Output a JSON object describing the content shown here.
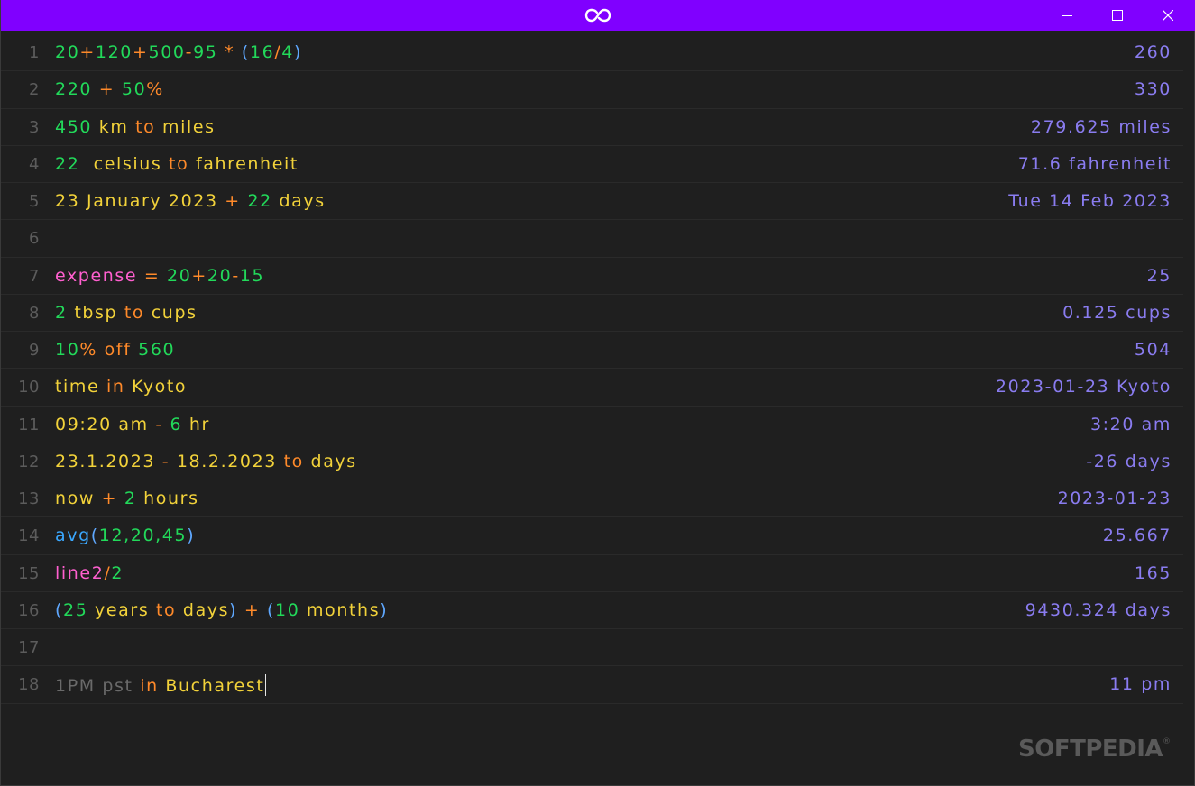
{
  "colors": {
    "titlebar": "#8000ff",
    "background": "#1f1f1f",
    "line_number": "#5c5c5c",
    "result": "#8a7cf0",
    "number": "#22d95a",
    "keyword": "#ff8a2a",
    "unit": "#f2d23a",
    "variable": "#ff5fcf",
    "paren": "#5fa8ff",
    "function": "#3aa8ff",
    "comment": "#6a6a6a"
  },
  "window": {
    "title_icon": "infinity-icon",
    "minimize_icon": "minimize-icon",
    "maximize_icon": "maximize-icon",
    "close_icon": "close-icon"
  },
  "lines": [
    {
      "n": "1",
      "tokens": [
        {
          "t": "20",
          "c": "number"
        },
        {
          "t": "+",
          "c": "keyword"
        },
        {
          "t": "120",
          "c": "number"
        },
        {
          "t": "+",
          "c": "keyword"
        },
        {
          "t": "500",
          "c": "number"
        },
        {
          "t": "-",
          "c": "keyword"
        },
        {
          "t": "95 ",
          "c": "number"
        },
        {
          "t": "* ",
          "c": "keyword"
        },
        {
          "t": "(",
          "c": "paren"
        },
        {
          "t": "16",
          "c": "number"
        },
        {
          "t": "/",
          "c": "keyword"
        },
        {
          "t": "4",
          "c": "number"
        },
        {
          "t": ")",
          "c": "paren"
        }
      ],
      "result": "260"
    },
    {
      "n": "2",
      "tokens": [
        {
          "t": "220 ",
          "c": "number"
        },
        {
          "t": "+ ",
          "c": "keyword"
        },
        {
          "t": "50",
          "c": "number"
        },
        {
          "t": "%",
          "c": "keyword"
        }
      ],
      "result": "330"
    },
    {
      "n": "3",
      "tokens": [
        {
          "t": "450 ",
          "c": "number"
        },
        {
          "t": "km ",
          "c": "unit"
        },
        {
          "t": "to ",
          "c": "keyword"
        },
        {
          "t": "miles",
          "c": "unit"
        }
      ],
      "result": "279.625 miles"
    },
    {
      "n": "4",
      "tokens": [
        {
          "t": "22  ",
          "c": "number"
        },
        {
          "t": "celsius ",
          "c": "unit"
        },
        {
          "t": "to ",
          "c": "keyword"
        },
        {
          "t": "fahrenheit",
          "c": "unit"
        }
      ],
      "result": "71.6 fahrenheit"
    },
    {
      "n": "5",
      "tokens": [
        {
          "t": "23 January 2023 ",
          "c": "unit"
        },
        {
          "t": "+ ",
          "c": "keyword"
        },
        {
          "t": "22 ",
          "c": "number"
        },
        {
          "t": "days",
          "c": "unit"
        }
      ],
      "result": "Tue 14 Feb 2023"
    },
    {
      "n": "6",
      "tokens": [],
      "result": ""
    },
    {
      "n": "7",
      "tokens": [
        {
          "t": "expense ",
          "c": "variable"
        },
        {
          "t": "= ",
          "c": "keyword"
        },
        {
          "t": "20",
          "c": "number"
        },
        {
          "t": "+",
          "c": "keyword"
        },
        {
          "t": "20",
          "c": "number"
        },
        {
          "t": "-",
          "c": "keyword"
        },
        {
          "t": "15",
          "c": "number"
        }
      ],
      "result": "25"
    },
    {
      "n": "8",
      "tokens": [
        {
          "t": "2 ",
          "c": "number"
        },
        {
          "t": "tbsp ",
          "c": "unit"
        },
        {
          "t": "to ",
          "c": "keyword"
        },
        {
          "t": "cups",
          "c": "unit"
        }
      ],
      "result": "0.125 cups"
    },
    {
      "n": "9",
      "tokens": [
        {
          "t": "10",
          "c": "number"
        },
        {
          "t": "% off ",
          "c": "keyword"
        },
        {
          "t": "560",
          "c": "number"
        }
      ],
      "result": "504"
    },
    {
      "n": "10",
      "tokens": [
        {
          "t": "time ",
          "c": "unit"
        },
        {
          "t": "in ",
          "c": "keyword"
        },
        {
          "t": "Kyoto",
          "c": "unit"
        }
      ],
      "result": "2023-01-23 Kyoto"
    },
    {
      "n": "11",
      "tokens": [
        {
          "t": "09:20 am ",
          "c": "unit"
        },
        {
          "t": "- ",
          "c": "keyword"
        },
        {
          "t": "6 ",
          "c": "number"
        },
        {
          "t": "hr",
          "c": "unit"
        }
      ],
      "result": "3:20 am"
    },
    {
      "n": "12",
      "tokens": [
        {
          "t": "23.1.2023 ",
          "c": "unit"
        },
        {
          "t": "- ",
          "c": "keyword"
        },
        {
          "t": "18.2.2023 ",
          "c": "unit"
        },
        {
          "t": "to ",
          "c": "keyword"
        },
        {
          "t": "days",
          "c": "unit"
        }
      ],
      "result": "-26 days"
    },
    {
      "n": "13",
      "tokens": [
        {
          "t": "now ",
          "c": "unit"
        },
        {
          "t": "+ ",
          "c": "keyword"
        },
        {
          "t": "2 ",
          "c": "number"
        },
        {
          "t": "hours",
          "c": "unit"
        }
      ],
      "result": "2023-01-23"
    },
    {
      "n": "14",
      "tokens": [
        {
          "t": "avg",
          "c": "function"
        },
        {
          "t": "(",
          "c": "paren"
        },
        {
          "t": "12,20,45",
          "c": "number"
        },
        {
          "t": ")",
          "c": "paren"
        }
      ],
      "result": "25.667"
    },
    {
      "n": "15",
      "tokens": [
        {
          "t": "line2",
          "c": "variable"
        },
        {
          "t": "/",
          "c": "keyword"
        },
        {
          "t": "2",
          "c": "number"
        }
      ],
      "result": "165"
    },
    {
      "n": "16",
      "tokens": [
        {
          "t": "(",
          "c": "paren"
        },
        {
          "t": "25 ",
          "c": "number"
        },
        {
          "t": "years ",
          "c": "unit"
        },
        {
          "t": "to ",
          "c": "keyword"
        },
        {
          "t": "days",
          "c": "unit"
        },
        {
          "t": ") ",
          "c": "paren"
        },
        {
          "t": "+ ",
          "c": "keyword"
        },
        {
          "t": "(",
          "c": "paren"
        },
        {
          "t": "10 ",
          "c": "number"
        },
        {
          "t": "months",
          "c": "unit"
        },
        {
          "t": ")",
          "c": "paren"
        }
      ],
      "result": "9430.324 days"
    },
    {
      "n": "17",
      "tokens": [],
      "result": ""
    },
    {
      "n": "18",
      "tokens": [
        {
          "t": "1PM pst ",
          "c": "comment"
        },
        {
          "t": "in ",
          "c": "keyword"
        },
        {
          "t": "Bucharest",
          "c": "unit"
        }
      ],
      "result": "11 pm",
      "cursor": true
    }
  ],
  "watermark": {
    "text": "SOFTPEDIA",
    "mark": "®"
  }
}
